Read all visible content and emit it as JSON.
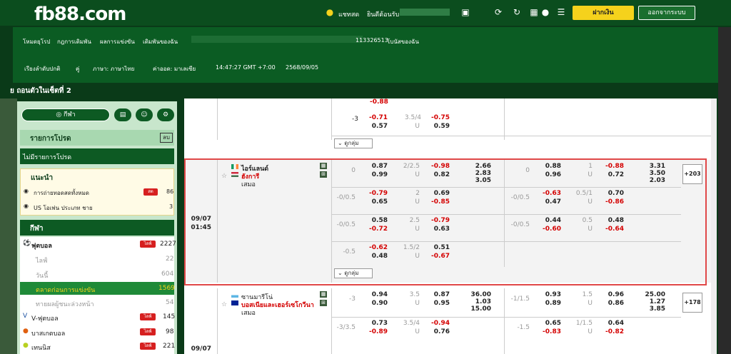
{
  "brand": {
    "logo": "fb88.com"
  },
  "top": {
    "chat": "แชทสด",
    "welcome": "ยินดีต้อนรับ",
    "deposit": "ฝากเงิน",
    "logout": "ออกจากระบบ"
  },
  "header": {
    "links": [
      "โหมดยุโรป",
      "กฎการเดิมพัน",
      "ผลการแข่งขัน",
      "เดิมพันของฉัน"
    ],
    "account_id": "113326513",
    "bonus": "โบนัสของฉัน",
    "settings": [
      "เรียงลำดับปกติ",
      "คู่",
      "ภาษา: ภาษาไทย",
      "ค่าออด: มาเลเซีย",
      "14:47:27 GMT +7:00",
      "2568/09/05"
    ]
  },
  "title": "ย ถอนตัวในเซ็ตที่ 2",
  "sidebar": {
    "sports_btn": "กีฬา",
    "favorites": "รายการโปรด",
    "fav_clear": "ลบ",
    "no_fav": "ไม่มีรายการโปรด",
    "recommend": "แนะนำ",
    "rec_items": [
      {
        "label": "การถ่ายทอดสดทั้งหมด",
        "badge": "สด",
        "count": "86"
      },
      {
        "label": "US โอเพ่น ประเภท ชาย",
        "count": "3"
      }
    ],
    "sports": "กีฬา",
    "sport_items": [
      {
        "label": "ฟุตบอล",
        "badge": "ไลฟ์",
        "count": "2227"
      },
      {
        "label": "ไลฟ์",
        "count": "22"
      },
      {
        "label": "วันนี้",
        "count": "604"
      },
      {
        "label": "ตลาดก่อนการแข่งขัน",
        "count": "1569"
      },
      {
        "label": "ทายผลผู้ชนะล่วงหน้า",
        "count": "54"
      },
      {
        "label": "V-ฟุตบอล",
        "badge": "ไลฟ์",
        "count": "145"
      },
      {
        "label": "บาสเกตบอล",
        "badge": "ไลฟ์",
        "count": "98"
      },
      {
        "label": "เทนนิส",
        "badge": "ไลฟ์",
        "count": "221"
      }
    ]
  },
  "more_label": "ดูกลุ่ม",
  "match1": {
    "date": "09/07",
    "time": "01:45",
    "team1": "ไอร์แลนด์",
    "team2": "ฮังการี",
    "draw": "เสมอ",
    "more": "+203"
  },
  "match2": {
    "date": "09/07",
    "team1": "ซานมารีโน่",
    "team2": "บอสเนียและเฮอร์เซโกวีนา",
    "draw": "เสมอ",
    "more": "+178"
  },
  "toprow": {
    "l_hdp": "-3",
    "l_h1": "-0.71",
    "l_h2": "0.57",
    "l_ou": "3.5/4",
    "l_u": "U",
    "l_o1": "-0.75",
    "l_o2": "0.59"
  },
  "m1rows": [
    {
      "hdp": "0",
      "h1": "0.87",
      "h2": "0.99",
      "ou": "2/2.5",
      "u": "U",
      "o1": "-0.98",
      "o2": "0.82",
      "x1": "2.66",
      "x2": "2.83",
      "x3": "3.05",
      "rhdp": "0",
      "rh1": "0.88",
      "rh2": "0.96",
      "rou": "1",
      "ru": "U",
      "ro1": "-0.88",
      "ro2": "0.72",
      "rx1": "3.31",
      "rx2": "3.50",
      "rx3": "2.03"
    },
    {
      "hdp": "-0/0.5",
      "h1": "-0.79",
      "h2": "0.65",
      "ou": "2",
      "u": "U",
      "o1": "0.69",
      "o2": "-0.85",
      "rhdp": "-0/0.5",
      "rh1": "-0.63",
      "rh2": "0.47",
      "rou": "0.5/1",
      "ru": "U",
      "ro1": "0.70",
      "ro2": "-0.86"
    },
    {
      "hdp": "-0/0.5",
      "h1": "0.58",
      "h2": "-0.72",
      "ou": "2.5",
      "u": "U",
      "o1": "-0.79",
      "o2": "0.63",
      "rhdp": "-0/0.5",
      "rh1": "0.44",
      "rh2": "-0.60",
      "rou": "0.5",
      "ru": "U",
      "ro1": "0.48",
      "ro2": "-0.64"
    },
    {
      "hdp": "-0.5",
      "h1": "-0.62",
      "h2": "0.48",
      "ou": "1.5/2",
      "u": "U",
      "o1": "0.51",
      "o2": "-0.67"
    }
  ],
  "m2rows": [
    {
      "hdp": "-3",
      "h1": "0.94",
      "h2": "0.90",
      "ou": "3.5",
      "u": "U",
      "o1": "0.87",
      "o2": "0.95",
      "x1": "36.00",
      "x2": "1.03",
      "x3": "15.00",
      "rhdp": "-1/1.5",
      "rh1": "0.93",
      "rh2": "0.89",
      "rou": "1.5",
      "ru": "U",
      "ro1": "0.96",
      "ro2": "0.86",
      "rx1": "25.00",
      "rx2": "1.27",
      "rx3": "3.85"
    },
    {
      "hdp": "-3/3.5",
      "h1": "0.73",
      "h2": "-0.89",
      "ou": "3.5/4",
      "u": "U",
      "o1": "-0.94",
      "o2": "0.76",
      "rhdp": "-1.5",
      "rh1": "0.65",
      "rh2": "-0.83",
      "rou": "1/1.5",
      "ru": "U",
      "ro1": "0.64",
      "ro2": "-0.82"
    }
  ]
}
